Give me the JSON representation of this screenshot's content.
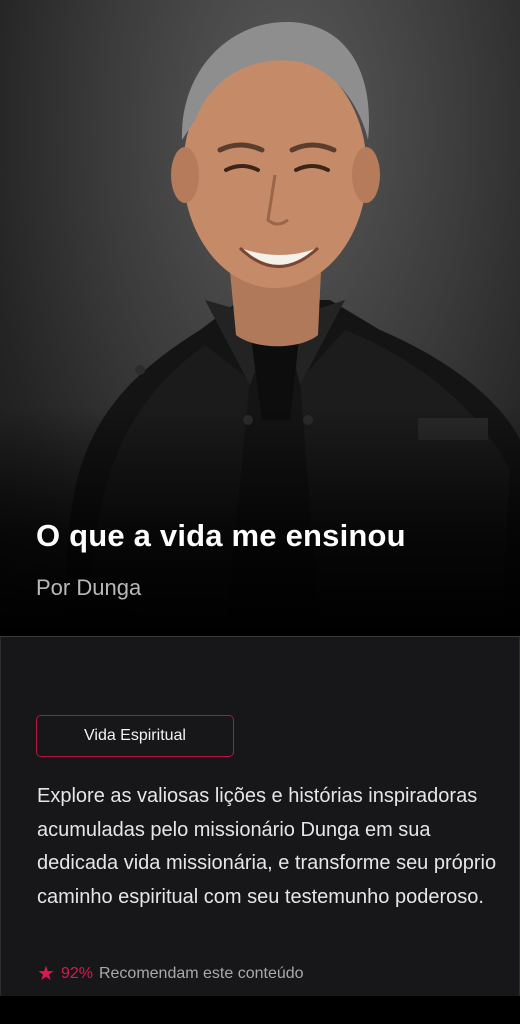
{
  "course": {
    "title": "O que a vida me ensinou",
    "author": "Por Dunga",
    "category": "Vida Espiritual",
    "description": "Explore as valiosas lições e histórias inspiradoras acumuladas pelo missionário Dunga em sua dedicada vida missionária, e transforme seu próprio caminho espiritual com seu testemunho poderoso.",
    "rating": {
      "icon": "star-icon",
      "percent": "92%",
      "label": "Recomendam este conteúdo"
    }
  },
  "colors": {
    "accent": "#d81b4f",
    "chip_border": "#b3173f",
    "card_bg": "#171618"
  }
}
